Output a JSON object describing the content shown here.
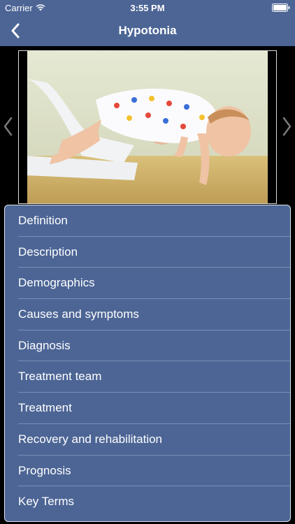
{
  "status_bar": {
    "carrier": "Carrier",
    "time": "3:55 PM"
  },
  "nav": {
    "title": "Hypotonia",
    "back_icon": "chevron-left-icon"
  },
  "image": {
    "prev_icon": "chevron-left-icon",
    "next_icon": "chevron-right-icon"
  },
  "menu": {
    "items": [
      {
        "label": "Definition"
      },
      {
        "label": "Description"
      },
      {
        "label": "Demographics"
      },
      {
        "label": "Causes and symptoms"
      },
      {
        "label": "Diagnosis"
      },
      {
        "label": "Treatment team"
      },
      {
        "label": "Treatment"
      },
      {
        "label": "Recovery and rehabilitation"
      },
      {
        "label": "Prognosis"
      },
      {
        "label": "Key Terms"
      }
    ]
  },
  "colors": {
    "header": "#4c6595",
    "menu_background": "#4c6595",
    "separator": "#7c90b5",
    "page_background": "#000000"
  }
}
